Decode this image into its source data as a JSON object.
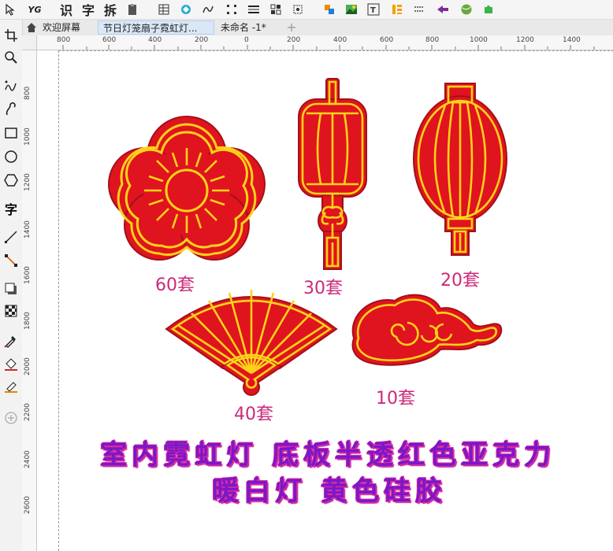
{
  "toolbar": {
    "ocr_label": "识",
    "text_label": "字",
    "split_label": "拆",
    "yg_label": "YG"
  },
  "tabs": [
    {
      "label": "欢迎屏幕"
    },
    {
      "label": "节日灯笼扇子霓虹灯..."
    },
    {
      "label": "未命名 -1*"
    }
  ],
  "tools": {
    "text_tool_label": "字"
  },
  "ruler": {
    "h_ticks": [
      "800",
      "600",
      "400",
      "200",
      "0",
      "200",
      "400",
      "600",
      "800",
      "1000",
      "1200",
      "1400"
    ],
    "v_ticks": [
      "800",
      "1000",
      "1200",
      "1400",
      "1600",
      "1800",
      "2000",
      "2200",
      "2400",
      "2600"
    ]
  },
  "canvas": {
    "quantities": {
      "flower": "60套",
      "lantern_tall": "30套",
      "lantern_round": "20套",
      "fan": "40套",
      "cloud": "10套"
    },
    "caption_line1": "室内霓虹灯 底板半透红色亚克力",
    "caption_line2": "暖白灯 黄色硅胶"
  },
  "colors": {
    "red_fill": "#e0141e",
    "neon_yellow": "#ffd21a",
    "outline_dark": "#a3101a",
    "caption_purple": "#7a18c8",
    "caption_pink": "#e02aa0",
    "qty_pink": "#cc2a7a"
  }
}
